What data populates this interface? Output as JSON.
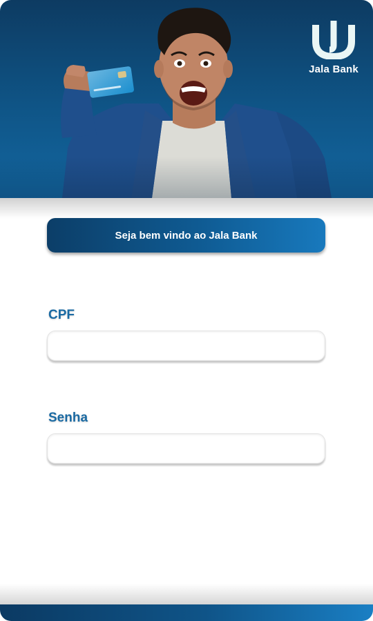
{
  "brand": {
    "name": "Jala Bank",
    "logo_icon": "jala-j-logo-icon"
  },
  "hero": {
    "image": "excited-man-holding-credit-card"
  },
  "welcome": {
    "text": "Seja bem vindo ao Jala Bank"
  },
  "form": {
    "cpf": {
      "label": "CPF",
      "value": "",
      "placeholder": ""
    },
    "senha": {
      "label": "Senha",
      "value": "",
      "placeholder": ""
    }
  },
  "colors": {
    "primary_dark": "#0c3e68",
    "primary": "#0f5b93",
    "primary_light": "#1879bd",
    "label": "#1a6aa3",
    "background": "#ffffff"
  }
}
